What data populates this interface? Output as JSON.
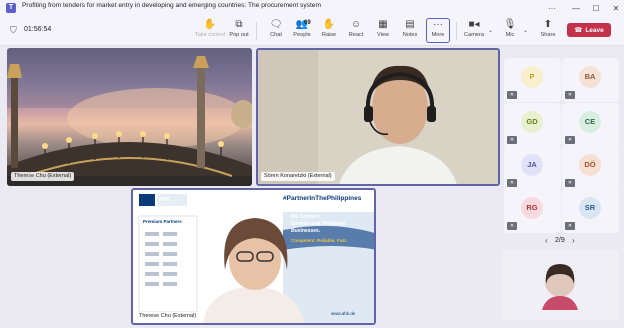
{
  "window": {
    "title": "Profiting from tenders for market entry in developing and emerging countries: The procurement system of the ..."
  },
  "toolbar": {
    "timer": "01:56:54",
    "buttons": [
      {
        "id": "take-control",
        "label": "Take control",
        "icon": "hand-icon",
        "disabled": true
      },
      {
        "id": "pop-out",
        "label": "Pop out",
        "icon": "pop-out-icon",
        "disabled": false
      },
      {
        "id": "chat",
        "label": "Chat",
        "icon": "chat-icon",
        "disabled": false
      },
      {
        "id": "people",
        "label": "People",
        "icon": "people-icon",
        "disabled": false,
        "count": "69"
      },
      {
        "id": "raise",
        "label": "Raise",
        "icon": "raise-hand-icon",
        "disabled": false
      },
      {
        "id": "react",
        "label": "React",
        "icon": "smiley-icon",
        "disabled": false
      },
      {
        "id": "view",
        "label": "View",
        "icon": "view-icon",
        "disabled": false
      },
      {
        "id": "notes",
        "label": "Notes",
        "icon": "notes-icon",
        "disabled": false
      },
      {
        "id": "more",
        "label": "More",
        "icon": "more-icon",
        "disabled": false
      },
      {
        "id": "camera",
        "label": "Camera",
        "icon": "camera-icon",
        "disabled": false
      },
      {
        "id": "mic",
        "label": "Mic",
        "icon": "mic-icon",
        "disabled": false
      },
      {
        "id": "share",
        "label": "Share",
        "icon": "share-icon",
        "disabled": false
      }
    ],
    "leave_label": "Leave"
  },
  "stage": {
    "tile1_name": "Therese Chu (External)",
    "tile2_name": "Sören Konaretzki (External)",
    "tile3_name": "Therese Chu (External)",
    "slide": {
      "org": "AHK",
      "brand": "#PartnerInThePhilippines",
      "partners_heading": "Premium Partners",
      "tagline_1": "We Connect",
      "tagline_2": "German and Philippine",
      "tagline_3": "Businesses.",
      "subline": "Competent. Reliable. Fast.",
      "url": "www.ahk.de"
    }
  },
  "roster": {
    "participants": [
      {
        "initials": "P",
        "color": "#c9a227",
        "bg": "#f8efce"
      },
      {
        "initials": "BA",
        "color": "#8a5a3a",
        "bg": "#f4e2d6"
      },
      {
        "initials": "GD",
        "color": "#6a7f1f",
        "bg": "#e9f0cf"
      },
      {
        "initials": "CE",
        "color": "#2d6b4a",
        "bg": "#d9eee1"
      },
      {
        "initials": "JA",
        "color": "#4f55a3",
        "bg": "#e1e2f7"
      },
      {
        "initials": "DÖ",
        "color": "#a0522d",
        "bg": "#f6e0d4"
      },
      {
        "initials": "RG",
        "color": "#a23b4a",
        "bg": "#f6dade"
      },
      {
        "initials": "SR",
        "color": "#2f5d8a",
        "bg": "#d8e6f4"
      }
    ],
    "page": "2/9"
  }
}
